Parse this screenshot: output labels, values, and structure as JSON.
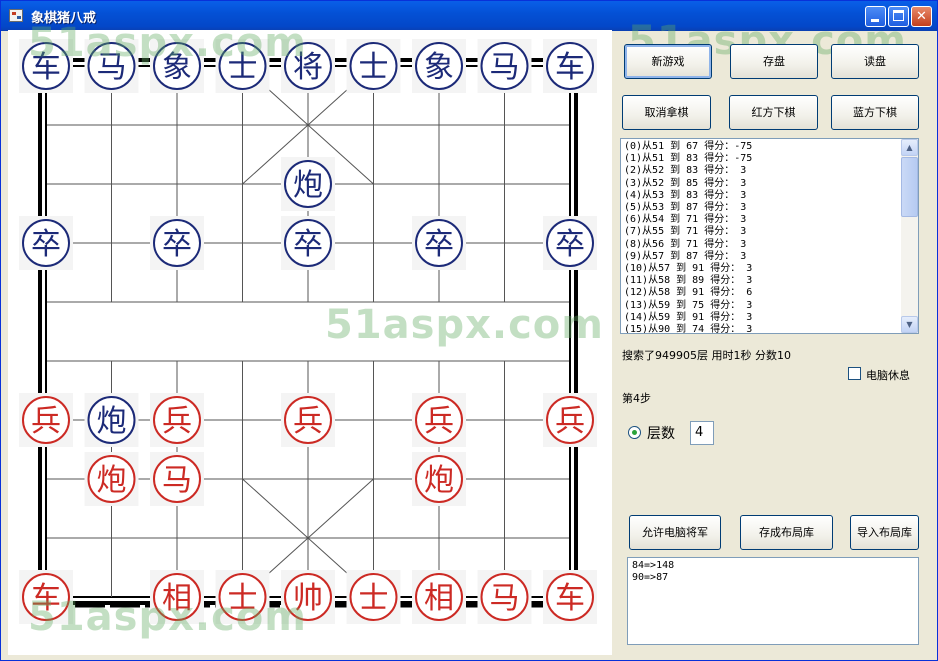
{
  "window": {
    "title": "象棋猪八戒",
    "minimize_glyph": "",
    "maximize_glyph": "",
    "close_glyph": "✕"
  },
  "watermark": "51aspx.com",
  "board": {
    "river_text": "",
    "pieces": [
      {
        "char": "车",
        "side": "blue",
        "col": 0,
        "row": 0
      },
      {
        "char": "马",
        "side": "blue",
        "col": 1,
        "row": 0
      },
      {
        "char": "象",
        "side": "blue",
        "col": 2,
        "row": 0
      },
      {
        "char": "士",
        "side": "blue",
        "col": 3,
        "row": 0
      },
      {
        "char": "将",
        "side": "blue",
        "col": 4,
        "row": 0
      },
      {
        "char": "士",
        "side": "blue",
        "col": 5,
        "row": 0
      },
      {
        "char": "象",
        "side": "blue",
        "col": 6,
        "row": 0
      },
      {
        "char": "马",
        "side": "blue",
        "col": 7,
        "row": 0
      },
      {
        "char": "车",
        "side": "blue",
        "col": 8,
        "row": 0
      },
      {
        "char": "炮",
        "side": "blue",
        "col": 4,
        "row": 2
      },
      {
        "char": "卒",
        "side": "blue",
        "col": 0,
        "row": 3
      },
      {
        "char": "卒",
        "side": "blue",
        "col": 2,
        "row": 3
      },
      {
        "char": "卒",
        "side": "blue",
        "col": 4,
        "row": 3
      },
      {
        "char": "卒",
        "side": "blue",
        "col": 6,
        "row": 3
      },
      {
        "char": "卒",
        "side": "blue",
        "col": 8,
        "row": 3
      },
      {
        "char": "兵",
        "side": "red",
        "col": 0,
        "row": 6
      },
      {
        "char": "炮",
        "side": "blue",
        "col": 1,
        "row": 6
      },
      {
        "char": "兵",
        "side": "red",
        "col": 2,
        "row": 6
      },
      {
        "char": "兵",
        "side": "red",
        "col": 4,
        "row": 6
      },
      {
        "char": "兵",
        "side": "red",
        "col": 6,
        "row": 6
      },
      {
        "char": "兵",
        "side": "red",
        "col": 8,
        "row": 6
      },
      {
        "char": "炮",
        "side": "red",
        "col": 1,
        "row": 7
      },
      {
        "char": "马",
        "side": "red",
        "col": 2,
        "row": 7
      },
      {
        "char": "炮",
        "side": "red",
        "col": 6,
        "row": 7
      },
      {
        "char": "车",
        "side": "red",
        "col": 0,
        "row": 9
      },
      {
        "char": "相",
        "side": "red",
        "col": 2,
        "row": 9
      },
      {
        "char": "士",
        "side": "red",
        "col": 3,
        "row": 9
      },
      {
        "char": "帅",
        "side": "red",
        "col": 4,
        "row": 9
      },
      {
        "char": "士",
        "side": "red",
        "col": 5,
        "row": 9
      },
      {
        "char": "相",
        "side": "red",
        "col": 6,
        "row": 9
      },
      {
        "char": "马",
        "side": "red",
        "col": 7,
        "row": 9
      },
      {
        "char": "车",
        "side": "red",
        "col": 8,
        "row": 9
      }
    ]
  },
  "colors": {
    "blue_piece": "#1c2a78",
    "red_piece": "#cc2a24",
    "window_border": "#0831d9"
  },
  "buttons": {
    "new_game": "新游戏",
    "save": "存盘",
    "load": "读盘",
    "undo": "取消拿棋",
    "red_move": "红方下棋",
    "blue_move": "蓝方下棋",
    "allow_check": "允许电脑将军",
    "save_opening": "存成布局库",
    "import_opening": "导入布局库"
  },
  "moves_list": [
    "(0)从51 到 67 得分：-75",
    "(1)从51 到 83 得分：-75",
    "(2)从52 到 83 得分： 3",
    "(3)从52 到 85 得分： 3",
    "(4)从53 到 83 得分： 3",
    "(5)从53 到 87 得分： 3",
    "(6)从54 到 71 得分： 3",
    "(7)从55 到 71 得分： 3",
    "(8)从56 到 71 得分： 3",
    "(9)从57 到 87 得分： 3",
    "(10)从57 到 91 得分： 3",
    "(11)从58 到 89 得分： 3",
    "(12)从58 到 91 得分： 6",
    "(13)从59 到 75 得分： 3",
    "(14)从59 到 91 得分： 3",
    "(15)从90 到 74 得分： 3"
  ],
  "status": {
    "search_info": "搜索了949905层  用时1秒 分数10",
    "step": "第4步",
    "computer_rest_label": "电脑休息",
    "depth_label": "层数",
    "depth_value": "4"
  },
  "log_lines": [
    "84=>148",
    "90=>87"
  ]
}
